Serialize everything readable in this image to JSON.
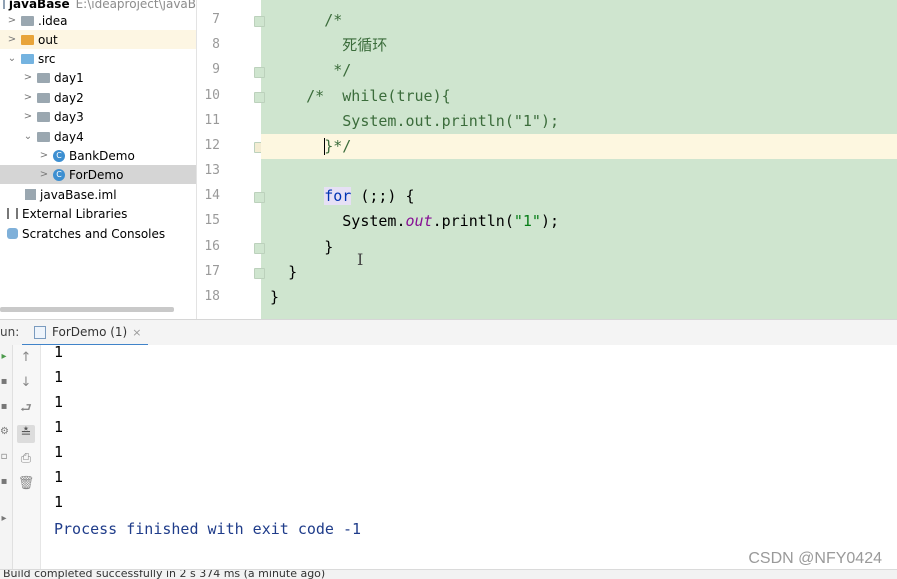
{
  "project": {
    "root_name": "javaBase",
    "root_path": "E:\\ideaproject\\javaB",
    "items": [
      {
        "label": ".idea"
      },
      {
        "label": "out"
      },
      {
        "label": "src"
      },
      {
        "label": "day1"
      },
      {
        "label": "day2"
      },
      {
        "label": "day3"
      },
      {
        "label": "day4"
      },
      {
        "label": "BankDemo"
      },
      {
        "label": "ForDemo"
      },
      {
        "label": "javaBase.iml"
      },
      {
        "label": "External Libraries"
      },
      {
        "label": "Scratches and Consoles"
      }
    ]
  },
  "editor": {
    "line_numbers": [
      "7",
      "8",
      "9",
      "10",
      "11",
      "12",
      "13",
      "14",
      "15",
      "16",
      "17",
      "18"
    ],
    "code": {
      "l7": "/*",
      "l8": "死循环",
      "l9": "*/",
      "l10": "/*  while(true){",
      "l11": "System.out.println(\"1\");",
      "l12": "}*/",
      "l14_kw": "for",
      "l14_rest": " (;;) {",
      "l15_a": "System.",
      "l15_field": "out",
      "l15_b": ".println(",
      "l15_str": "\"1\"",
      "l15_c": ");",
      "l16": "}",
      "l17": "}",
      "l18": "}"
    },
    "cursor_symbol": "I"
  },
  "run": {
    "label": "un:",
    "tab_label": "ForDemo (1)",
    "tab_close": "×",
    "output_lines": [
      "1",
      "1",
      "1",
      "1",
      "1",
      "1",
      "1"
    ],
    "finished": "Process finished with exit code -1"
  },
  "watermark": "CSDN @NFY0424",
  "status_bar": "Build completed successfully in 2 s 374 ms (a minute ago)",
  "colors": {
    "editor_bg": "#cfe5cf",
    "current_line": "#fdf7e0",
    "keyword": "#0033b3",
    "string": "#067d17",
    "selection": "#d5d5d5"
  }
}
